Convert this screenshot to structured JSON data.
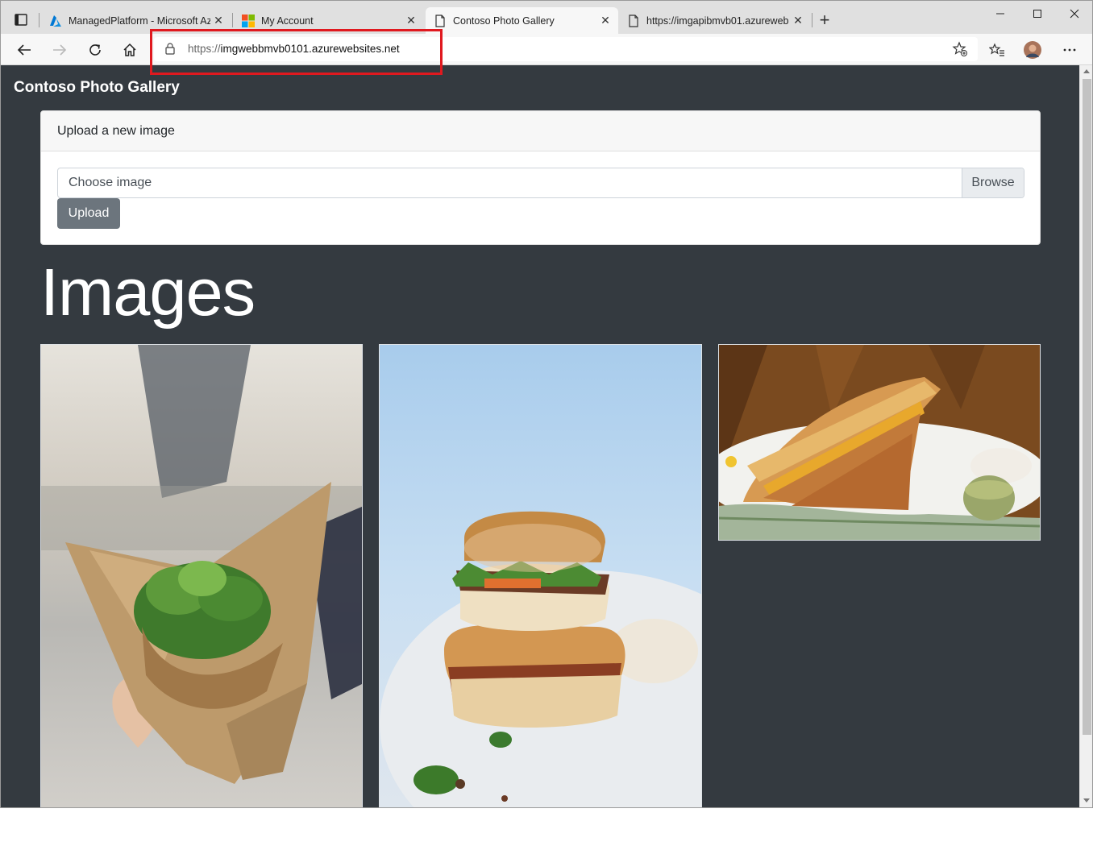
{
  "browser": {
    "tabs": [
      {
        "title": "ManagedPlatform - Microsoft Az",
        "icon": "azure-icon",
        "active": false
      },
      {
        "title": "My Account",
        "icon": "microsoft-logo-icon",
        "active": false
      },
      {
        "title": "Contoso Photo Gallery",
        "icon": "page-icon",
        "active": true
      },
      {
        "title": "https://imgapibmvb01.azureweb",
        "icon": "page-icon",
        "active": false
      }
    ],
    "address": {
      "scheme": "https://",
      "host": "imgwebbmvb0101.azurewebsites.net"
    }
  },
  "page": {
    "brand": "Contoso Photo Gallery",
    "upload_card": {
      "header": "Upload a new image",
      "file_placeholder": "Choose image",
      "browse_label": "Browse",
      "upload_label": "Upload"
    },
    "images_heading": "Images",
    "images": [
      {
        "subject": "salad sandwich in paper wrap"
      },
      {
        "subject": "stacked banh mi sandwich"
      },
      {
        "subject": "toasted cheese sandwich on plate"
      }
    ]
  },
  "colors": {
    "page_bg": "#343a40",
    "upload_button": "#6c757d",
    "highlight": "#e0191f"
  }
}
